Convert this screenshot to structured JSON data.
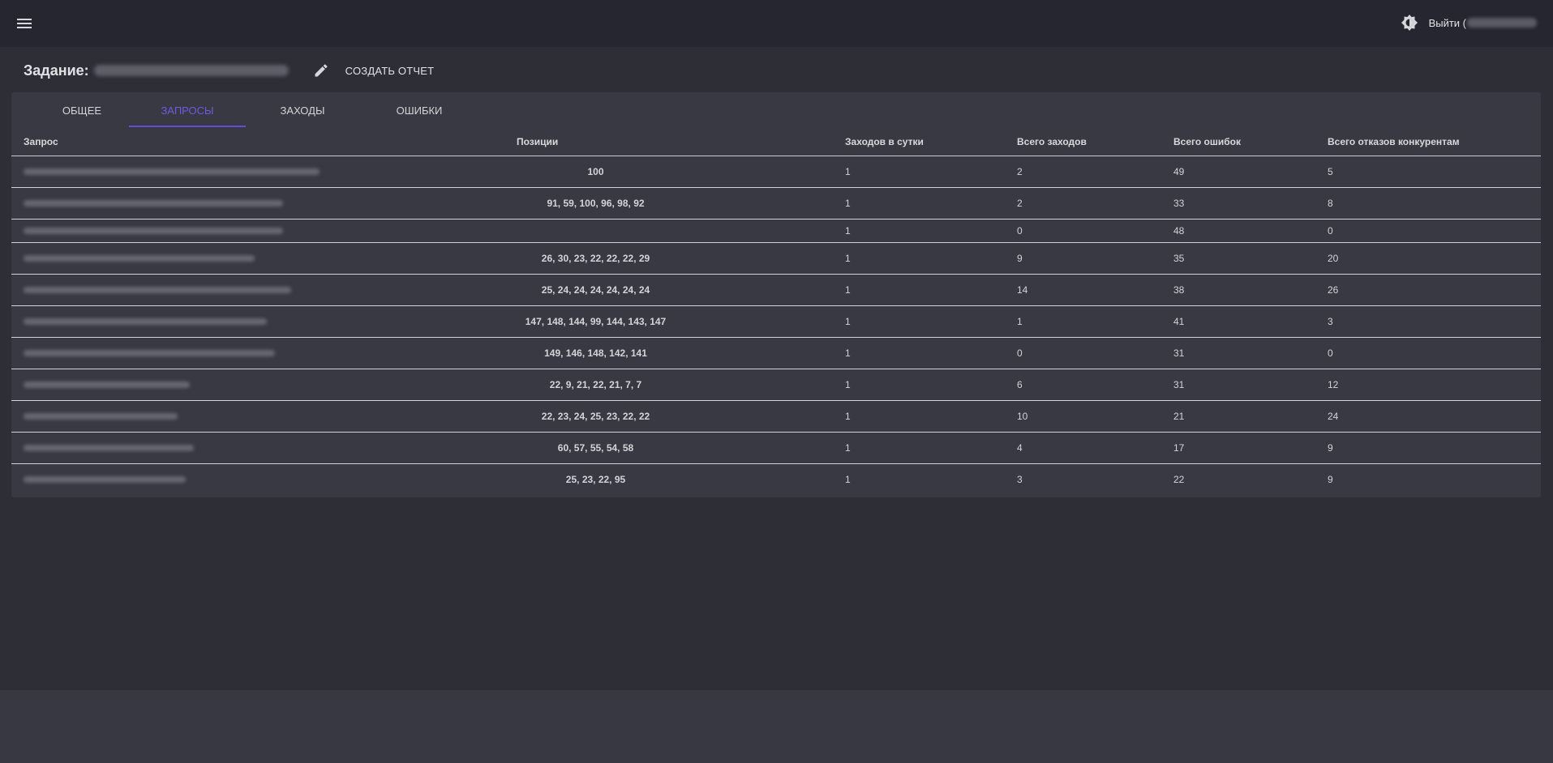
{
  "header": {
    "logout_label": "Выйти ("
  },
  "page": {
    "task_label": "Задание:",
    "create_report_label": "СОЗДАТЬ ОТЧЕТ"
  },
  "tabs": [
    {
      "label": "ОБЩЕЕ",
      "active": false
    },
    {
      "label": "ЗАПРОСЫ",
      "active": true
    },
    {
      "label": "ЗАХОДЫ",
      "active": false
    },
    {
      "label": "ОШИБКИ",
      "active": false
    }
  ],
  "colors": {
    "accent": "#6c5ce0",
    "appbar": "#25262f",
    "card": "#383942"
  },
  "icons": {
    "menu": "menu-icon",
    "theme": "brightness-icon",
    "edit": "pencil-icon"
  },
  "table": {
    "columns": [
      "Запрос",
      "Позиции",
      "Заходов в сутки",
      "Всего заходов",
      "Всего ошибок",
      "Всего отказов конкурентам"
    ],
    "rows": [
      {
        "positions": "100",
        "per_day": "1",
        "total_visits": "2",
        "total_errors": "49",
        "refusals": "5"
      },
      {
        "positions": "91, 59, 100, 96, 98, 92",
        "per_day": "1",
        "total_visits": "2",
        "total_errors": "33",
        "refusals": "8"
      },
      {
        "positions": "",
        "per_day": "1",
        "total_visits": "0",
        "total_errors": "48",
        "refusals": "0"
      },
      {
        "positions": "26, 30, 23, 22, 22, 22, 29",
        "per_day": "1",
        "total_visits": "9",
        "total_errors": "35",
        "refusals": "20"
      },
      {
        "positions": "25, 24, 24, 24, 24, 24, 24",
        "per_day": "1",
        "total_visits": "14",
        "total_errors": "38",
        "refusals": "26"
      },
      {
        "positions": "147, 148, 144, 99, 144, 143, 147",
        "per_day": "1",
        "total_visits": "1",
        "total_errors": "41",
        "refusals": "3"
      },
      {
        "positions": "149, 146, 148, 142, 141",
        "per_day": "1",
        "total_visits": "0",
        "total_errors": "31",
        "refusals": "0"
      },
      {
        "positions": "22, 9, 21, 22, 21, 7, 7",
        "per_day": "1",
        "total_visits": "6",
        "total_errors": "31",
        "refusals": "12"
      },
      {
        "positions": "22, 23, 24, 25, 23, 22, 22",
        "per_day": "1",
        "total_visits": "10",
        "total_errors": "21",
        "refusals": "24"
      },
      {
        "positions": "60, 57, 55, 54, 58",
        "per_day": "1",
        "total_visits": "4",
        "total_errors": "17",
        "refusals": "9"
      },
      {
        "positions": "25, 23, 22, 95",
        "per_day": "1",
        "total_visits": "3",
        "total_errors": "22",
        "refusals": "9"
      }
    ]
  }
}
